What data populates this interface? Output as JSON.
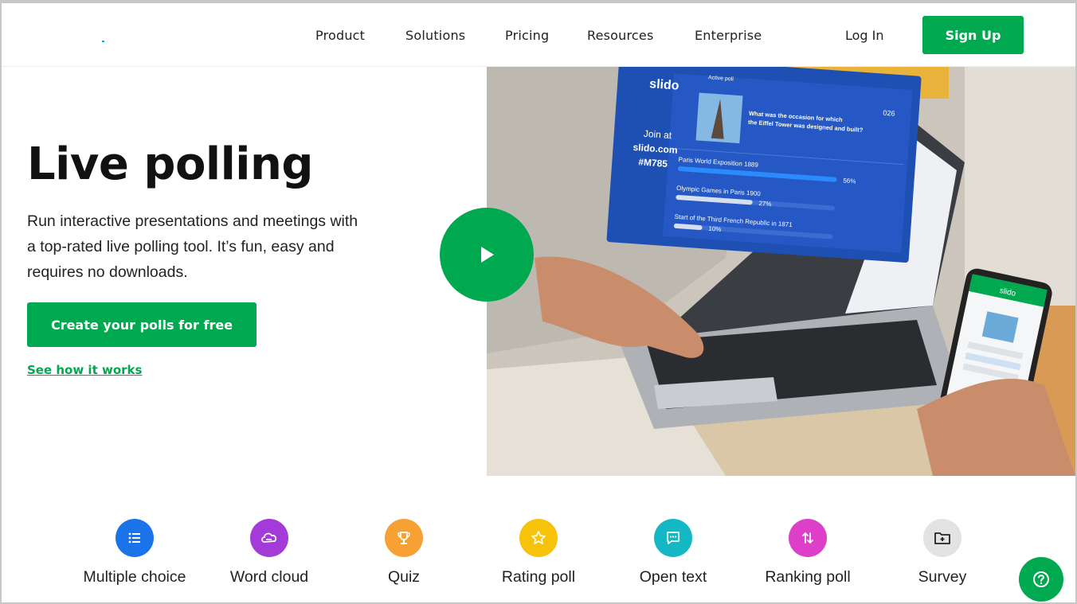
{
  "nav": {
    "items": [
      "Product",
      "Solutions",
      "Pricing",
      "Resources",
      "Enterprise"
    ],
    "login": "Log In",
    "signup": "Sign Up"
  },
  "hero": {
    "title": "Live polling",
    "description": "Run interactive presentations and meetings with a top-rated live polling tool. It’s fun, easy and requires no downloads.",
    "cta": "Create your polls for free",
    "link": "See how it works"
  },
  "poll_card": {
    "brand": "slido",
    "active_label": "Active poll",
    "join_line1": "Join at",
    "join_line2": "slido.com",
    "join_code": "#M785",
    "counter": "026",
    "question_line1": "What was the occasion for which",
    "question_line2": "the Eiffel Tower was designed and built?",
    "options": [
      {
        "label": "Paris World Exposition 1889",
        "percent": 56,
        "display": "56%"
      },
      {
        "label": "Olympic Games in Paris 1900",
        "percent": 27,
        "display": "27%"
      },
      {
        "label": "Start of the Third French Republic in 1871",
        "percent": 10,
        "display": "10%"
      }
    ]
  },
  "phone": {
    "brand": "slido"
  },
  "features": [
    {
      "label": "Multiple choice",
      "color": "#1a73e8",
      "icon": "list-icon"
    },
    {
      "label": "Word cloud",
      "color": "#a43ad8",
      "icon": "cloud-icon"
    },
    {
      "label": "Quiz",
      "color": "#f7a033",
      "icon": "trophy-icon"
    },
    {
      "label": "Rating poll",
      "color": "#f7c20a",
      "icon": "star-icon"
    },
    {
      "label": "Open text",
      "color": "#13b8c4",
      "icon": "chat-icon"
    },
    {
      "label": "Ranking poll",
      "color": "#de3fc8",
      "icon": "sort-arrows-icon"
    },
    {
      "label": "Survey",
      "color": "#e3e3e3",
      "icon": "survey-folder-icon"
    }
  ],
  "colors": {
    "brand_green": "#00a84f",
    "poll_blue": "#1e4fb2"
  }
}
